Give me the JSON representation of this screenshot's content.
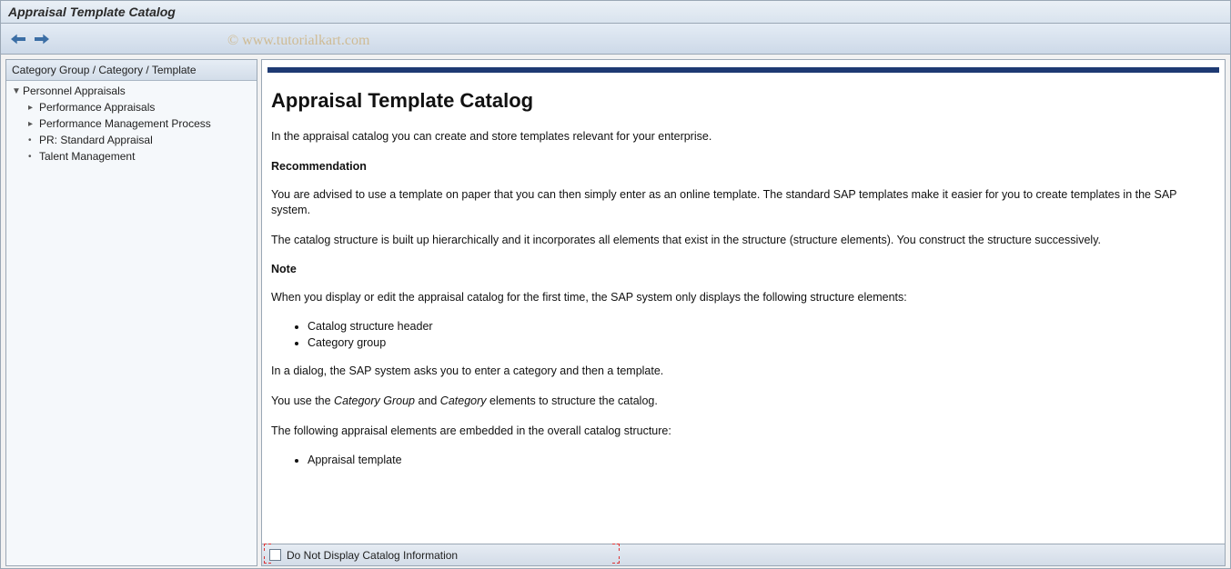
{
  "window": {
    "title": "Appraisal Template Catalog"
  },
  "watermark": "© www.tutorialkart.com",
  "sidebar": {
    "header": "Category Group / Category / Template",
    "root": {
      "label": "Personnel Appraisals"
    },
    "items": [
      {
        "label": "Performance Appraisals"
      },
      {
        "label": "Performance Management Process"
      },
      {
        "label": "PR: Standard Appraisal"
      },
      {
        "label": "Talent Management"
      }
    ]
  },
  "doc": {
    "h1": "Appraisal Template Catalog",
    "p1": "In the appraisal catalog you can create and store templates relevant for your enterprise.",
    "rec_h": "Recommendation",
    "p2": "You are advised to use a template on paper that you can then simply enter as an online template. The standard SAP templates make it easier for you to create templates in the SAP system.",
    "p3": "The catalog structure is built up hierarchically and it incorporates all elements that exist in the structure (structure elements). You construct the structure successively.",
    "note_h": "Note",
    "p4": "When you display or edit the appraisal catalog for the first time, the SAP system only displays the following structure elements:",
    "list1": [
      "Catalog structure header",
      "Category group"
    ],
    "p5": "In a dialog, the SAP system asks you to enter a category and then a template.",
    "p6_pre": "You use the ",
    "p6_em1": "Category Group",
    "p6_mid": " and ",
    "p6_em2": "Category",
    "p6_post": " elements to structure the catalog.",
    "p7": "The following appraisal elements are embedded in the overall catalog structure:",
    "list2": [
      "Appraisal template"
    ]
  },
  "footer": {
    "checkbox_label": "Do Not Display Catalog Information"
  }
}
